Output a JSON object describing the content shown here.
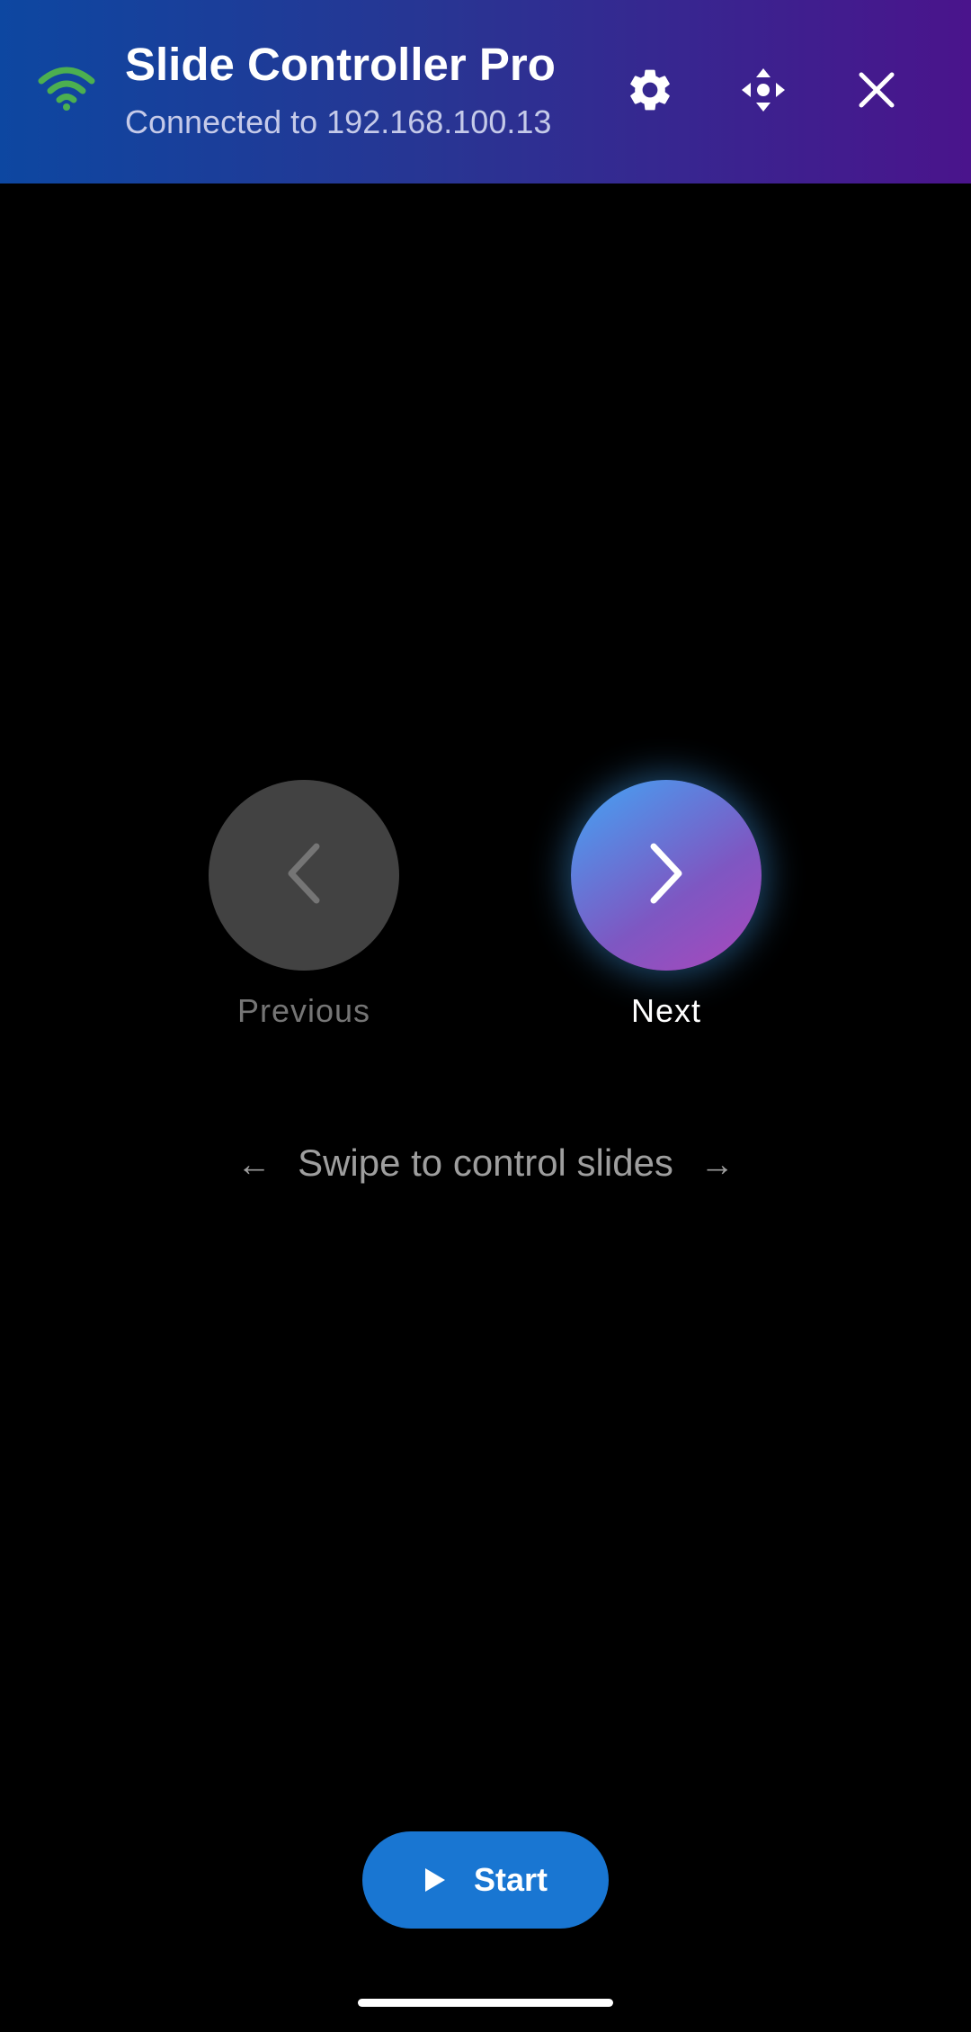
{
  "header": {
    "title": "Slide Controller Pro",
    "status": "Connected to 192.168.100.13",
    "wifi_icon": "wifi-icon",
    "connection_color": "#4caf50",
    "buttons": {
      "settings_icon": "gear-icon",
      "move_icon": "move-arrows-icon",
      "close_icon": "close-icon"
    }
  },
  "controls": {
    "previous_label": "Previous",
    "next_label": "Next",
    "previous_icon": "chevron-left-icon",
    "next_icon": "chevron-right-icon"
  },
  "hint": {
    "left_arrow": "←",
    "text": "Swipe to control slides",
    "right_arrow": "→"
  },
  "start": {
    "label": "Start",
    "icon": "play-icon",
    "color": "#1976d2"
  },
  "colors": {
    "background": "#000000",
    "header_gradient_start": "#0d47a1",
    "header_gradient_end": "#4a148c"
  }
}
